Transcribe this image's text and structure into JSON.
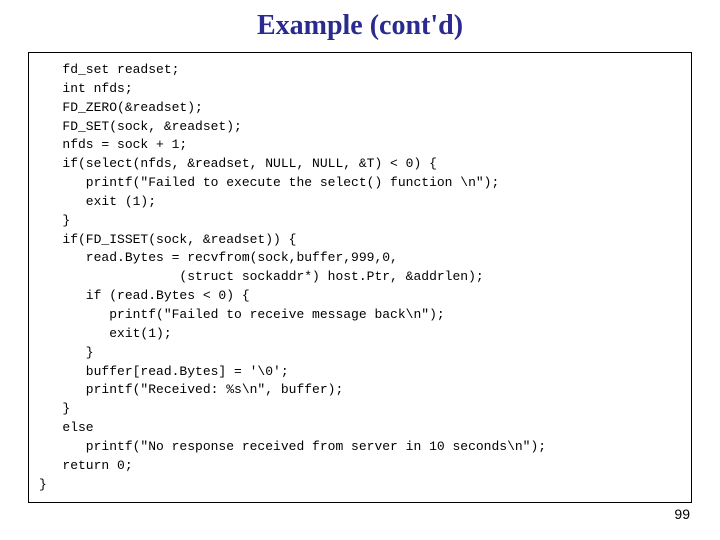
{
  "title": "Example (cont'd)",
  "code": "   fd_set readset;\n   int nfds;\n   FD_ZERO(&readset);\n   FD_SET(sock, &readset);\n   nfds = sock + 1;\n   if(select(nfds, &readset, NULL, NULL, &T) < 0) {\n      printf(\"Failed to execute the select() function \\n\");\n      exit (1);\n   }\n   if(FD_ISSET(sock, &readset)) {\n      read.Bytes = recvfrom(sock,buffer,999,0,\n                  (struct sockaddr*) host.Ptr, &addrlen);\n      if (read.Bytes < 0) {\n         printf(\"Failed to receive message back\\n\");\n         exit(1);\n      }\n      buffer[read.Bytes] = '\\0';\n      printf(\"Received: %s\\n\", buffer);\n   }\n   else\n      printf(\"No response received from server in 10 seconds\\n\");\n   return 0;\n}",
  "page_number": "99"
}
